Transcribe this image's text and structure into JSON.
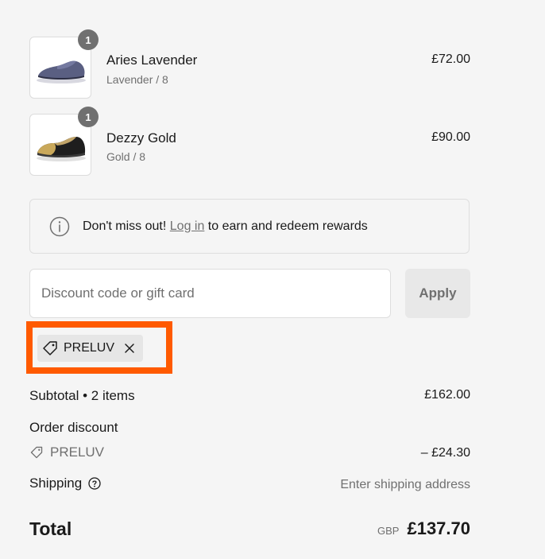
{
  "products": [
    {
      "name": "Aries Lavender",
      "variant": "Lavender / 8",
      "price": "£72.00",
      "quantity": "1",
      "image": "lavender-suede-loafer"
    },
    {
      "name": "Dezzy Gold",
      "variant": "Gold / 8",
      "price": "£90.00",
      "quantity": "1",
      "image": "gold-toe-black-loafer"
    }
  ],
  "rewards": {
    "icon": "info-icon",
    "prefix": "Don't miss out! ",
    "link": "Log in",
    "suffix": " to earn and redeem rewards"
  },
  "discount": {
    "placeholder": "Discount code or gift card",
    "value": "",
    "apply_label": "Apply",
    "applied_code": "PRELUV",
    "highlight_color": "#ff5a00"
  },
  "summary": {
    "subtotal_label": "Subtotal • 2 items",
    "subtotal_value": "£162.00",
    "order_discount_label": "Order discount",
    "discount_code": "PRELUV",
    "discount_value": "– £24.30",
    "shipping_label": "Shipping",
    "shipping_value": "Enter shipping address",
    "total_label": "Total",
    "currency": "GBP",
    "total_value": "£137.70"
  }
}
